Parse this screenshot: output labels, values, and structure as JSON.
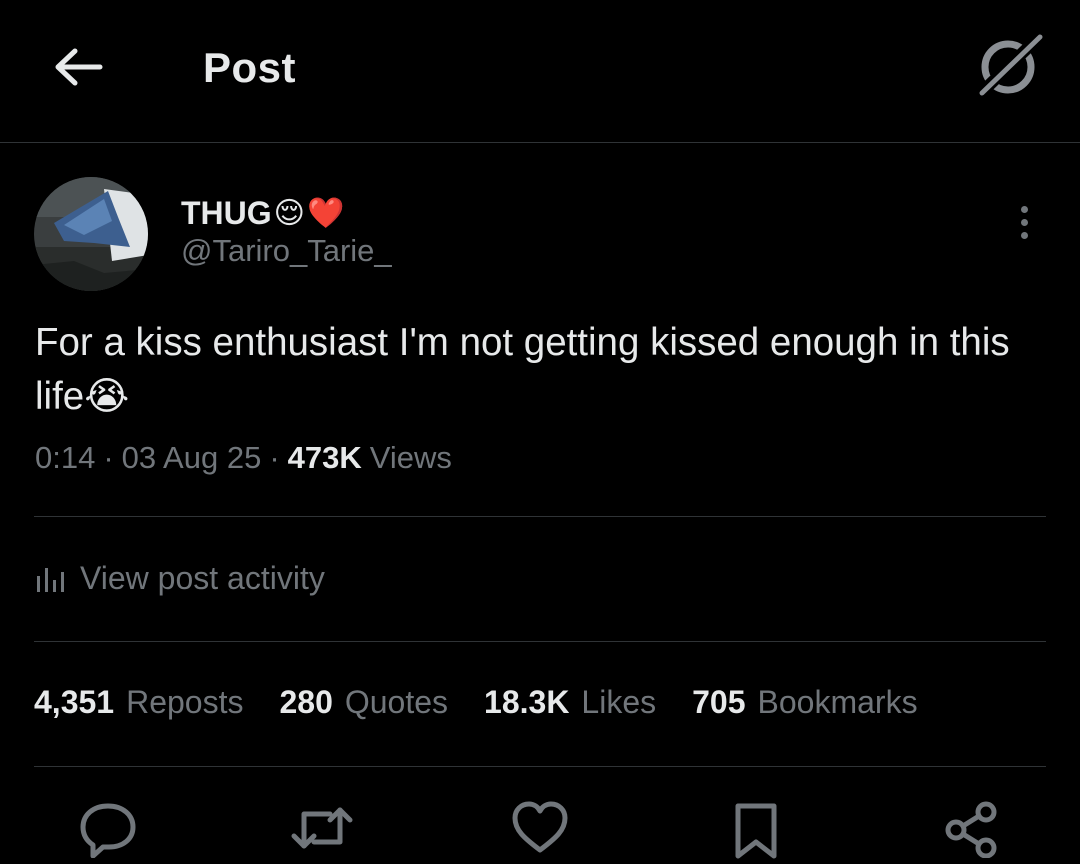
{
  "header": {
    "title": "Post",
    "back_icon": "arrow-left-icon",
    "grok_icon": "grok-icon"
  },
  "author": {
    "display_name": "THUG",
    "display_name_emoji": [
      "😌",
      "❤️"
    ],
    "handle": "@Tariro_Tarie_",
    "more_icon": "more-vertical-icon"
  },
  "post": {
    "text": "For a kiss enthusiast I'm not getting kissed enough in this life",
    "text_emoji": "😭",
    "time": "0:14",
    "date": "03 Aug 25",
    "views_count": "473K",
    "views_label": "Views",
    "separator": "·"
  },
  "activity": {
    "label": "View post activity",
    "icon": "analytics-icon"
  },
  "stats": [
    {
      "count": "4,351",
      "label": "Reposts"
    },
    {
      "count": "280",
      "label": "Quotes"
    },
    {
      "count": "18.3K",
      "label": "Likes"
    },
    {
      "count": "705",
      "label": "Bookmarks"
    }
  ],
  "actions": [
    "reply-icon",
    "repost-icon",
    "like-icon",
    "bookmark-icon",
    "share-icon"
  ],
  "colors": {
    "background": "#000000",
    "text": "#e7e9ea",
    "secondary": "#71767b",
    "divider": "#2f3336"
  }
}
